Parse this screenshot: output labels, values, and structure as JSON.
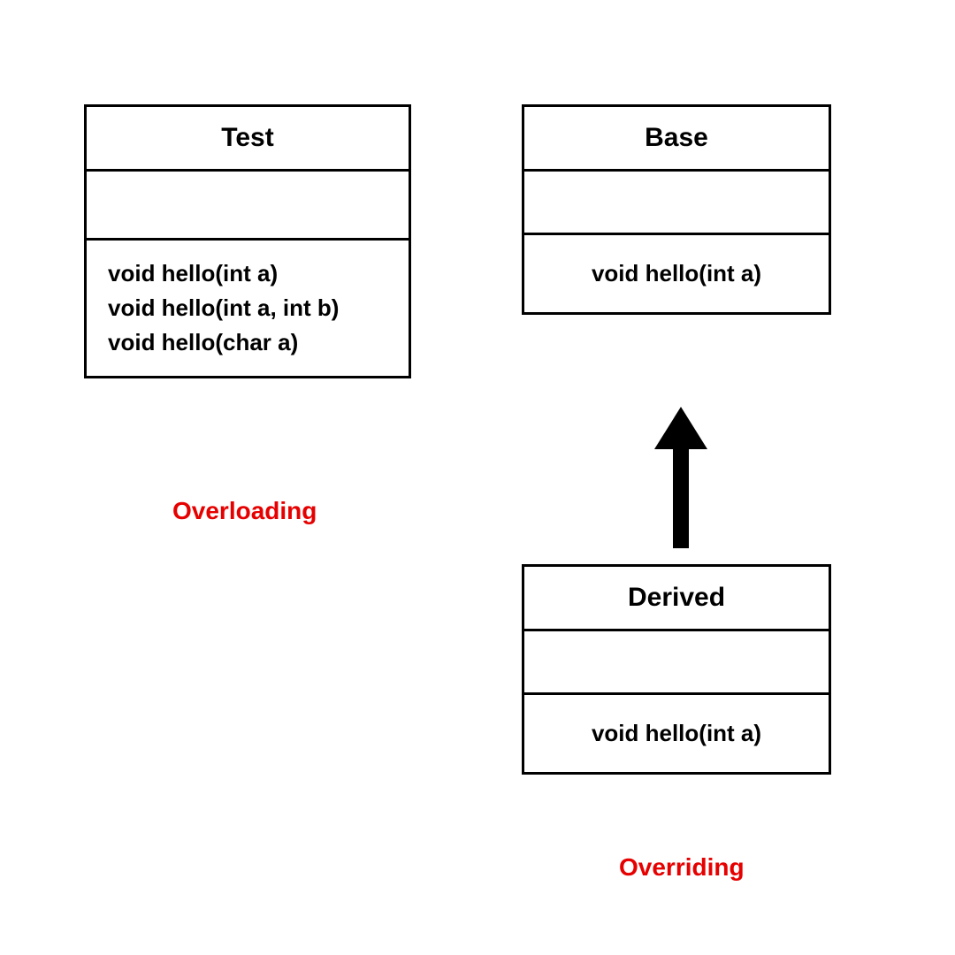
{
  "overloading": {
    "class_name": "Test",
    "methods": [
      "void hello(int a)",
      "void hello(int a, int b)",
      "void hello(char a)"
    ],
    "label": "Overloading"
  },
  "overriding": {
    "base": {
      "class_name": "Base",
      "method": "void hello(int a)"
    },
    "derived": {
      "class_name": "Derived",
      "method": "void hello(int a)"
    },
    "label": "Overriding"
  }
}
